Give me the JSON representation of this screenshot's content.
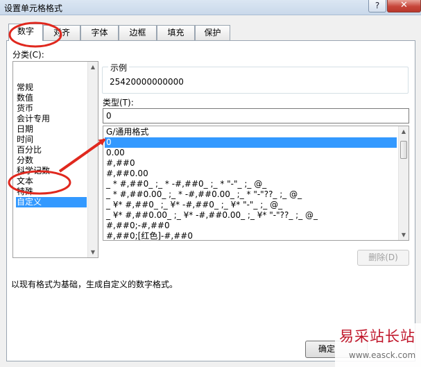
{
  "window": {
    "title": "设置单元格格式",
    "help_glyph": "?",
    "close_glyph": "✕"
  },
  "tabs": [
    {
      "label": "数字",
      "active": true
    },
    {
      "label": "对齐"
    },
    {
      "label": "字体"
    },
    {
      "label": "边框"
    },
    {
      "label": "填充"
    },
    {
      "label": "保护"
    }
  ],
  "category": {
    "label": "分类(C):",
    "items": [
      "常规",
      "数值",
      "货币",
      "会计专用",
      "日期",
      "时间",
      "百分比",
      "分数",
      "科学记数",
      "文本",
      "特殊",
      "自定义"
    ],
    "selected": "自定义"
  },
  "sample": {
    "label": "示例",
    "value": "25420000000000"
  },
  "type": {
    "label": "类型(T):",
    "value": "0",
    "formats": [
      "G/通用格式",
      "0",
      "0.00",
      "#,##0",
      "#,##0.00",
      "_ * #,##0_ ;_ * -#,##0_ ;_ * \"-\"_ ;_ @_ ",
      "_ * #,##0.00_ ;_ * -#,##0.00_ ;_ * \"-\"??_ ;_ @_ ",
      "_ ¥* #,##0_ ;_ ¥* -#,##0_ ;_ ¥* \"-\"_ ;_ @_ ",
      "_ ¥* #,##0.00_ ;_ ¥* -#,##0.00_ ;_ ¥* \"-\"??_ ;_ @_ ",
      "#,##0;-#,##0",
      "#,##0;[红色]-#,##0"
    ],
    "selected": "0"
  },
  "buttons": {
    "delete": "删除(D)",
    "ok": "确定"
  },
  "description": "以现有格式为基础，生成自定义的数字格式。",
  "watermark": {
    "site_name": "易采站长站",
    "url": "www.easck.com"
  },
  "annotation": {
    "color": "#e0281e"
  }
}
